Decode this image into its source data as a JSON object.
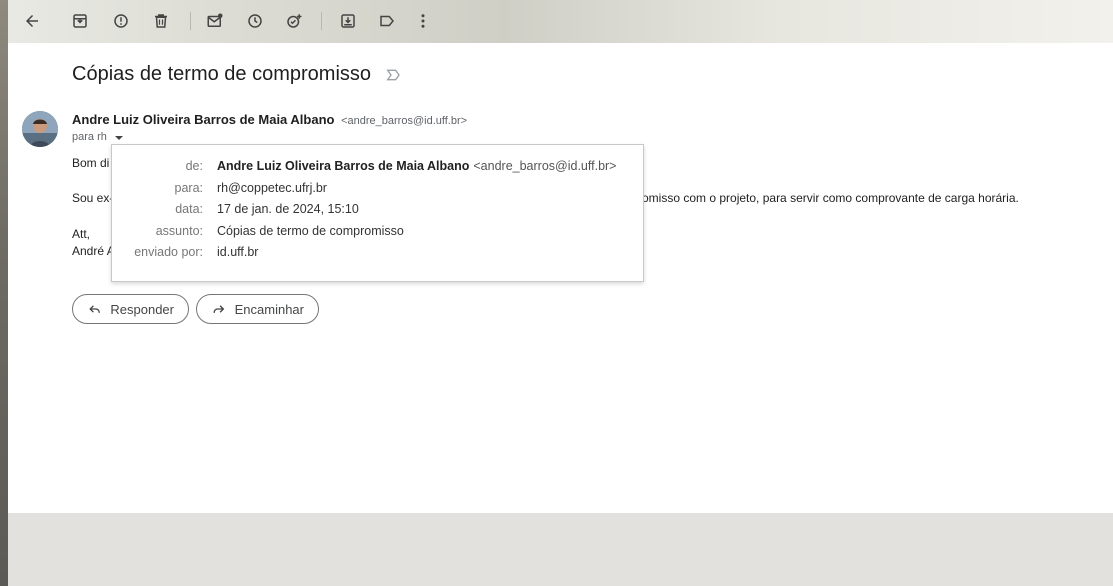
{
  "toolbar": {
    "icons": [
      "back-icon",
      "archive-icon",
      "report-spam-icon",
      "delete-icon",
      "mark-unread-icon",
      "snooze-icon",
      "add-task-icon",
      "move-to-icon",
      "label-icon",
      "more-options-icon"
    ]
  },
  "email": {
    "subject": "Cópias de termo de compromisso",
    "sender_name": "Andre Luiz Oliveira Barros de Maia Albano",
    "sender_email": "<andre_barros@id.uff.br>",
    "to_summary": "para rh",
    "body": {
      "greeting_fragment": "Bom di",
      "line1_start": "Sou ex-",
      "line1_end": "omisso com o projeto, para servir como comprovante de carga horária.",
      "signoff": "Att,",
      "signature_fragment": "André A"
    }
  },
  "details_popup": {
    "from_label": "de:",
    "from_name": "Andre Luiz Oliveira Barros de Maia Albano",
    "from_email": "<andre_barros@id.uff.br>",
    "to_label": "para:",
    "to_value": "rh@coppetec.ufrj.br",
    "date_label": "data:",
    "date_value": "17 de jan. de 2024, 15:10",
    "subject_label": "assunto:",
    "subject_value": "Cópias de termo de compromisso",
    "mailedby_label": "enviado por:",
    "mailedby_value": "id.uff.br"
  },
  "actions": {
    "reply_label": "Responder",
    "forward_label": "Encaminhar"
  }
}
